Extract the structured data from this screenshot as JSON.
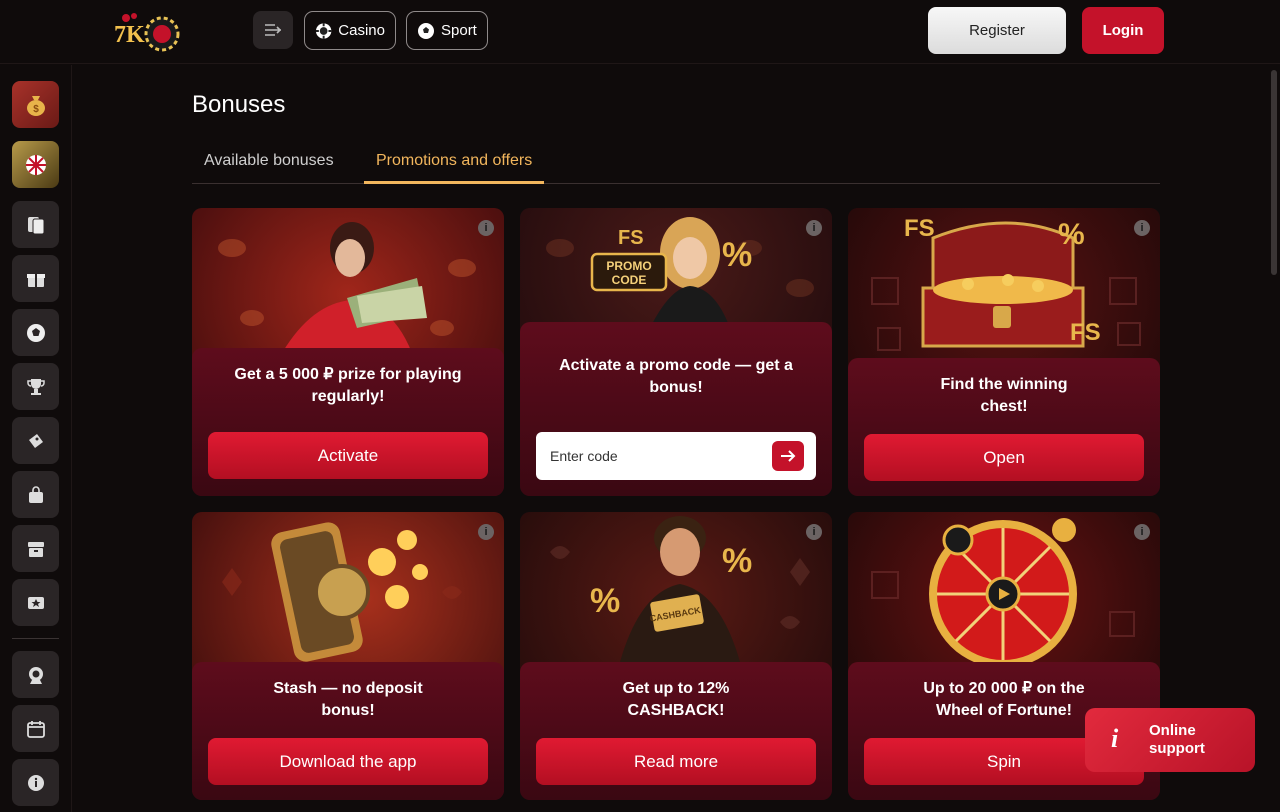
{
  "header": {
    "logo_text": "7K",
    "nav": [
      {
        "label": "Casino",
        "icon": "casino-chip-icon"
      },
      {
        "label": "Sport",
        "icon": "soccer-ball-icon"
      }
    ],
    "register_label": "Register",
    "login_label": "Login"
  },
  "sidebar": {
    "items": [
      {
        "icon": "money-bag-icon"
      },
      {
        "icon": "fortune-wheel-icon"
      },
      {
        "icon": "cards-icon"
      },
      {
        "icon": "gift-icon"
      },
      {
        "icon": "soccer-ball-icon"
      },
      {
        "icon": "trophy-icon"
      },
      {
        "icon": "ticket-icon"
      },
      {
        "icon": "shopping-bag-icon"
      },
      {
        "icon": "archive-icon"
      },
      {
        "icon": "vip-ticket-icon"
      },
      {
        "icon": "medal-icon"
      },
      {
        "icon": "calendar-icon"
      },
      {
        "icon": "info-icon"
      }
    ]
  },
  "page": {
    "title": "Bonuses",
    "tabs": [
      {
        "label": "Available bonuses",
        "active": false
      },
      {
        "label": "Promotions and offers",
        "active": true
      }
    ]
  },
  "cards": [
    {
      "title": "Get a 5 000 ₽ prize for playing regularly!",
      "button": "Activate"
    },
    {
      "title": "Activate a promo code — get a bonus!",
      "input_placeholder": "Enter code"
    },
    {
      "title": "Find the winning chest!",
      "button": "Open"
    },
    {
      "title": "Stash — no deposit bonus!",
      "button": "Download the app"
    },
    {
      "title": "Get up to 12% CASHBACK!",
      "button": "Read more"
    },
    {
      "title": "Up to 20 000 ₽ on the Wheel of Fortune!",
      "button": "Spin"
    }
  ],
  "support": {
    "label": "Online support"
  },
  "colors": {
    "accent": "#c4122a",
    "active_tab": "#f2b65d",
    "background": "#0f0b0b"
  }
}
